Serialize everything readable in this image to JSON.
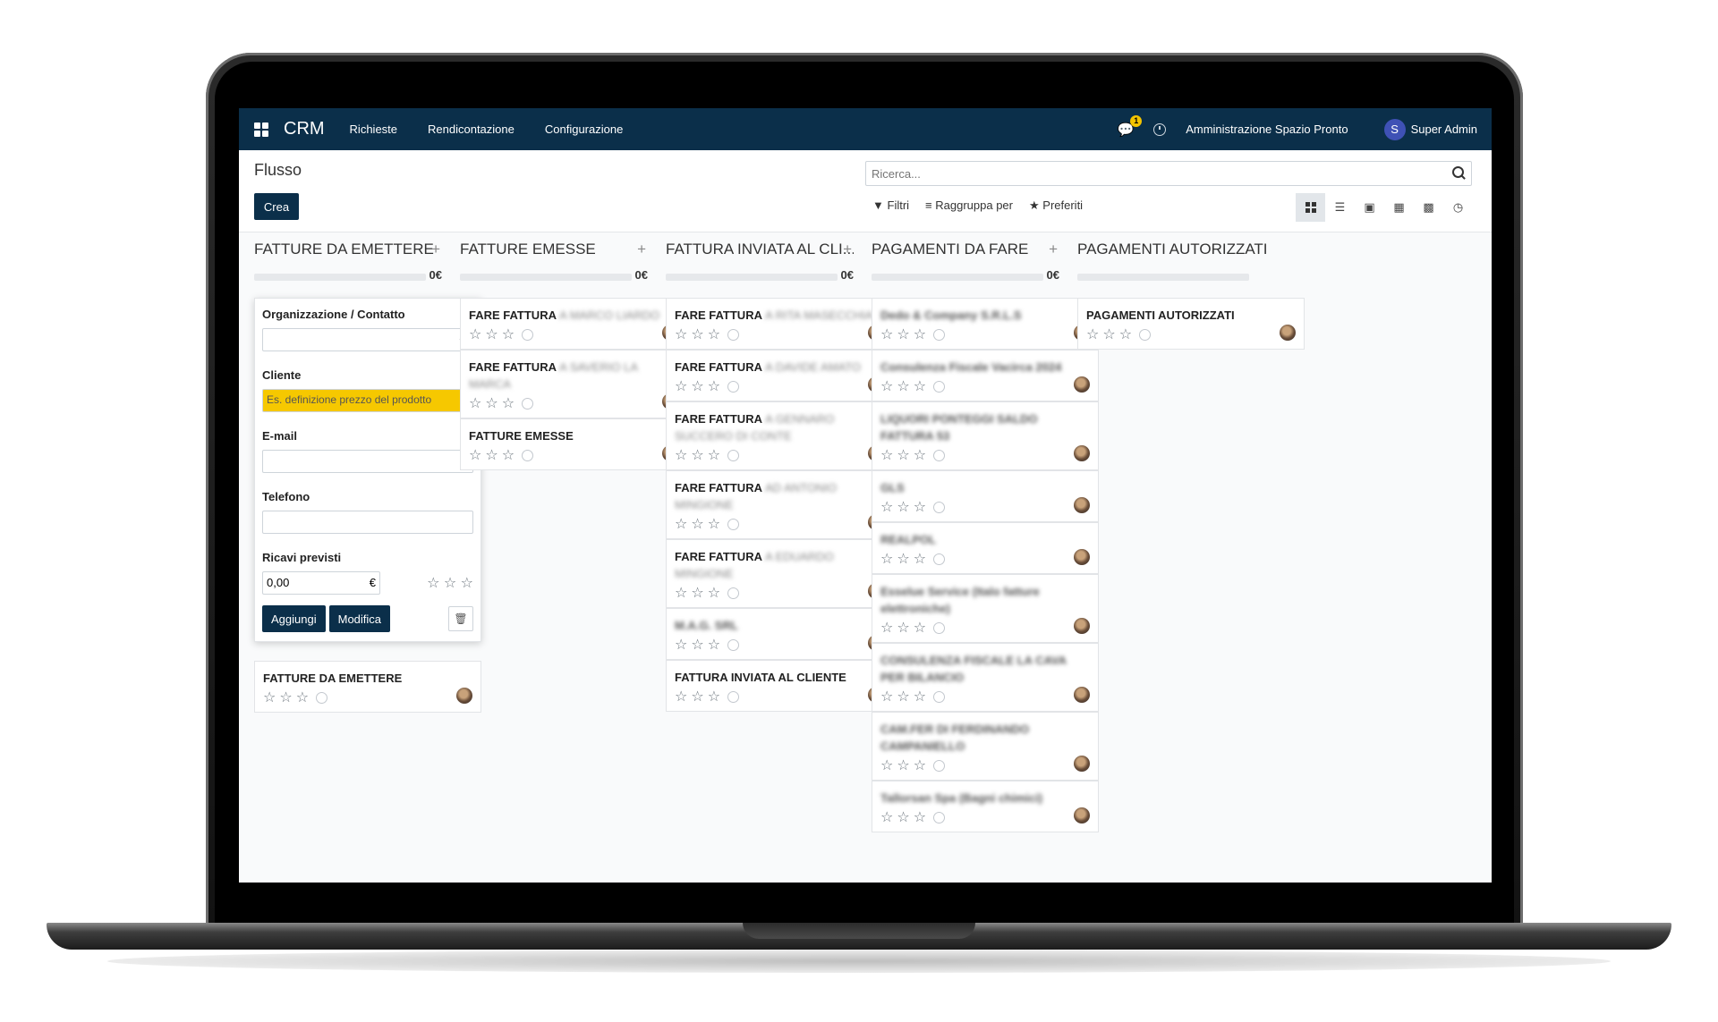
{
  "navbar": {
    "brand": "CRM",
    "menu": [
      "Richieste",
      "Rendicontazione",
      "Configurazione"
    ],
    "chat_badge": "1",
    "company": "Amministrazione Spazio Pronto",
    "user_initial": "S",
    "user_name": "Super Admin",
    "bg_color": "#0b2f4a"
  },
  "control_panel": {
    "title": "Flusso",
    "create_label": "Crea",
    "search_placeholder": "Ricerca...",
    "filters_label": "Filtri",
    "groupby_label": "Raggruppa per",
    "favorites_label": "Preferiti",
    "views": [
      "kanban",
      "list",
      "calendar",
      "pivot",
      "graph",
      "activity"
    ]
  },
  "columns": [
    {
      "title": "FATTURE DA EMETTERE",
      "sum": "0€",
      "quick_create": {
        "org_label": "Organizzazione / Contatto",
        "client_label": "Cliente",
        "client_placeholder": "Es. definizione prezzo del prodotto",
        "email_label": "E-mail",
        "phone_label": "Telefono",
        "revenue_label": "Ricavi previsti",
        "revenue_value": "0,00",
        "currency": "€",
        "add_label": "Aggiungi",
        "edit_label": "Modifica"
      },
      "cards": [
        {
          "title": "FATTURE DA EMETTERE",
          "detail": ""
        }
      ]
    },
    {
      "title": "FATTURE EMESSE",
      "sum": "0€",
      "cards": [
        {
          "title": "FARE FATTURA",
          "detail": "A MARCO LIARDO"
        },
        {
          "title": "FARE FATTURA",
          "detail": "A SAVERIO LA MARCA"
        },
        {
          "title": "FATTURE EMESSE",
          "detail": ""
        }
      ]
    },
    {
      "title": "FATTURA INVIATA AL CLI...",
      "sum": "0€",
      "cards": [
        {
          "title": "FARE FATTURA",
          "detail": "A RITA MASECCHIA"
        },
        {
          "title": "FARE FATTURA",
          "detail": "A DAVIDE AMATO"
        },
        {
          "title": "FARE FATTURA",
          "detail": "A GENNARO SUCCERO DI CONTE"
        },
        {
          "title": "FARE FATTURA",
          "detail": "AD ANTONIO MINGIONE"
        },
        {
          "title": "FARE FATTURA",
          "detail": "A EDUARDO MINGIONE"
        },
        {
          "title": "",
          "detail": "M.A.G. SRL"
        },
        {
          "title": "FATTURA INVIATA AL CLIENTE",
          "detail": ""
        }
      ]
    },
    {
      "title": "PAGAMENTI DA FARE",
      "sum": "0€",
      "cards": [
        {
          "title": "",
          "detail": "Dedo & Company S.R.L.S"
        },
        {
          "title": "",
          "detail": "Consulenza Fiscale Vacirca 2024"
        },
        {
          "title": "",
          "detail": "LIQUORI PONTEGGI SALDO FATTURA 53"
        },
        {
          "title": "",
          "detail": "GLS"
        },
        {
          "title": "",
          "detail": "REALPOL"
        },
        {
          "title": "",
          "detail": "Esselue Service (Italo fatture elettroniche)"
        },
        {
          "title": "",
          "detail": "CONSULENZA FISCALE LA CAVA PER BILANCIO"
        },
        {
          "title": "",
          "detail": "CAM.FER DI FERDINANDO CAMPANIELLO"
        },
        {
          "title": "",
          "detail": "Tallorsan Spa (Bagni chimici)"
        }
      ]
    },
    {
      "title": "PAGAMENTI AUTORIZZATI",
      "sum": "",
      "cards": [
        {
          "title": "PAGAMENTI AUTORIZZATI",
          "detail": ""
        }
      ]
    }
  ]
}
